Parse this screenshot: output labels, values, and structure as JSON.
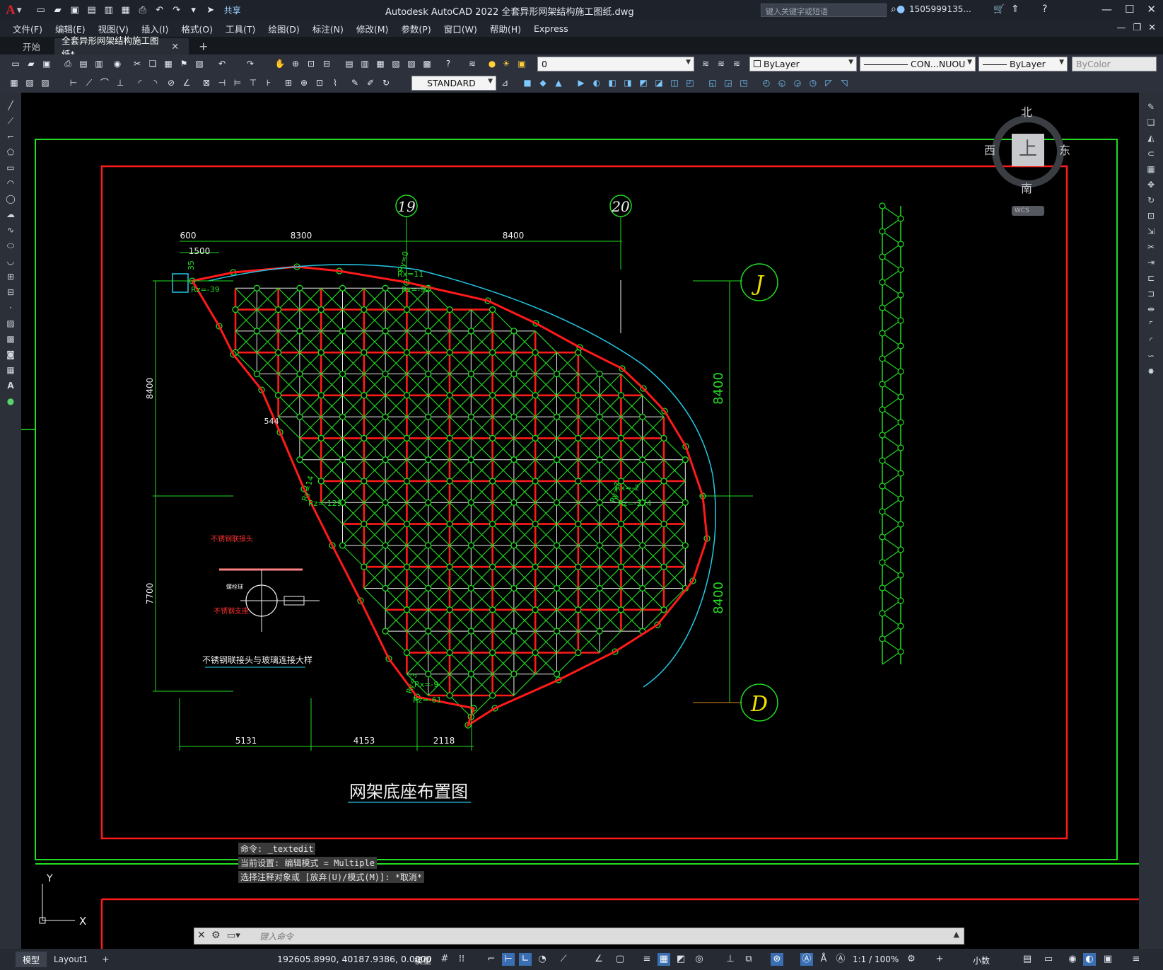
{
  "app": {
    "logo": "A",
    "title": "Autodesk AutoCAD 2022    全套异形网架结构施工图纸.dwg"
  },
  "quick_access": {
    "share_label": "共享"
  },
  "search": {
    "placeholder": "键入关键字或短语"
  },
  "user": {
    "name": "1505999135..."
  },
  "menu": [
    "文件(F)",
    "编辑(E)",
    "视图(V)",
    "插入(I)",
    "格式(O)",
    "工具(T)",
    "绘图(D)",
    "标注(N)",
    "修改(M)",
    "参数(P)",
    "窗口(W)",
    "帮助(H)",
    "Express"
  ],
  "tabs": {
    "start": "开始",
    "drawing": "全套异形网架结构施工图纸*"
  },
  "toolbar": {
    "layer_value": "0",
    "color_value": "ByLayer",
    "linetype_value": "CON...NUOU",
    "lineweight_value": "ByLayer",
    "plotstyle_value": "ByColor",
    "textstyle_value": "STANDARD"
  },
  "viewcube": {
    "north": "北",
    "south": "南",
    "east": "东",
    "west": "西",
    "top": "上",
    "wcs": "WCS"
  },
  "drawing": {
    "title": "网架底座布置图",
    "detail_title": "不锈钢联接头与玻璃连接大样",
    "detail_label1": "不锈钢联接头",
    "detail_label2": "不锈钢支座",
    "detail_label3": "螺栓球",
    "axis_19": "19",
    "axis_20": "20",
    "axis_J": "J",
    "axis_D": "D",
    "dim_top_600": "600",
    "dim_top_8300": "8300",
    "dim_top_8400": "8400",
    "dim_1500": "1500",
    "dim_35": "35",
    "dim_left_8400": "8400",
    "dim_left_7700": "7700",
    "dim_right_8400a": "8400",
    "dim_right_8400b": "8400",
    "dim_bottom_5131": "5131",
    "dim_bottom_4153": "4153",
    "dim_bottom_2118": "2118",
    "dim_544": "544",
    "r1": "Rz=-39",
    "r2a": "Rx=11",
    "r2b": "Rz=-92",
    "r3a": "Rx=-2",
    "r3b": "Rz=-274",
    "r4a": "Rz=-129",
    "r5a": "Rx=-9",
    "r5b": "Rz=-61",
    "ry1": "Ry=0",
    "ry2": "Ry=14",
    "ry3": "Ry=7",
    "ry4": "Ry=3",
    "ucs_x": "X",
    "ucs_y": "Y"
  },
  "command": {
    "line1": "命令: _textedit",
    "line2": "当前设置: 编辑模式 = Multiple",
    "line3": "选择注释对象或 [放弃(U)/模式(M)]: *取消*",
    "placeholder": "键入命令"
  },
  "status": {
    "model_tab": "模型",
    "layout_tab": "Layout1",
    "coords": "192605.8990, 40187.9386, 0.0000",
    "model_label": "模型",
    "scale": "1:1 / 100%",
    "units": "小数"
  },
  "colors": {
    "red": "#ff1a1a",
    "green": "#22dd22",
    "white": "#f0f0f0",
    "cyan": "#22c8e6",
    "yellow": "#f0e000"
  }
}
